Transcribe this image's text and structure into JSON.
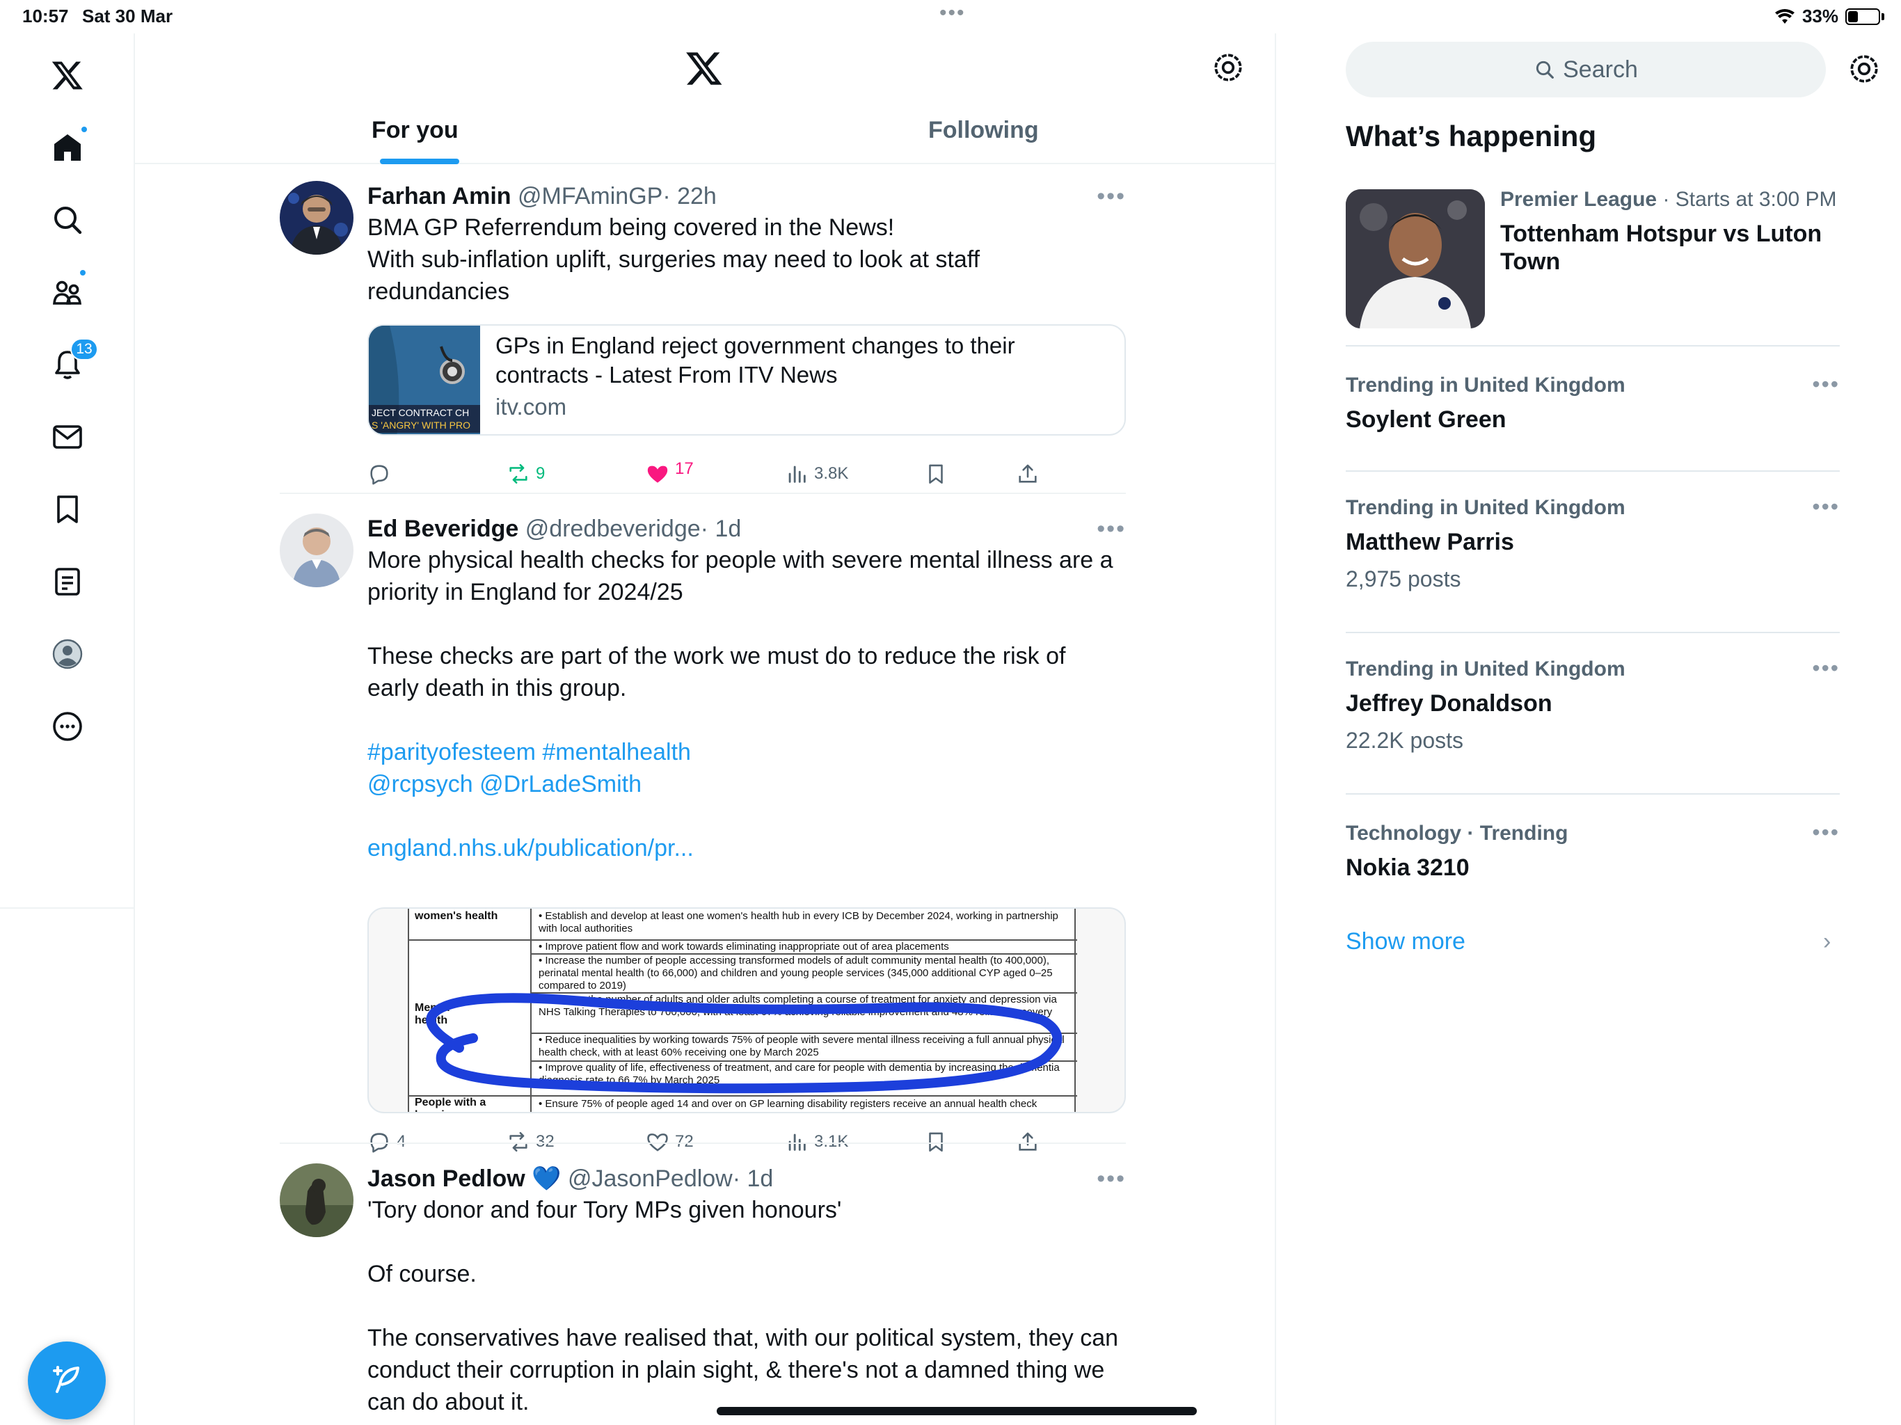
{
  "status": {
    "time": "10:57",
    "date": "Sat 30 Mar",
    "battery": "33%",
    "battery_level": 0.33
  },
  "nav": {
    "items": [
      "home",
      "explore",
      "communities",
      "notifications",
      "messages",
      "bookmarks",
      "lists",
      "profile",
      "more"
    ],
    "notifications_badge": "13"
  },
  "header": {
    "tabs": [
      {
        "label": "For you",
        "active": true
      },
      {
        "label": "Following",
        "active": false
      }
    ]
  },
  "tweets": [
    {
      "name": "Farhan Amin",
      "handle": "@MFAminGP",
      "time": "· 22h",
      "lines": [
        "BMA GP Referrendum being covered in the News!",
        "With sub-inflation uplift, surgeries may need to look at staff",
        "redundancies"
      ],
      "card": {
        "title_1": "GPs in England reject government changes to their",
        "title_2": "contracts - Latest From ITV News",
        "domain": "itv.com",
        "thumb_text_1": "JECT CONTRACT CH",
        "thumb_text_2": "S 'ANGRY' WITH PRO"
      },
      "replies": "",
      "reposts": "9",
      "likes": "17",
      "views": "3.8K",
      "liked": true,
      "reposted": true
    },
    {
      "name": "Ed Beveridge",
      "handle": "@dredbeveridge",
      "time": "· 1d",
      "lines": [
        "More physical health checks for people with severe mental illness are a",
        "priority in England for 2024/25",
        "",
        "These checks are part of the work we must do to reduce the risk of",
        "early death in this group.",
        ""
      ],
      "hashtags": "#parityofesteem #mentalhealth",
      "mentions": "@rcpsych @DrLadeSmith",
      "link": "england.nhs.uk/publication/pr...",
      "doc": {
        "label_womens": "women's health",
        "label_mental": "Mental health",
        "label_people": "People with a learning",
        "b1": "Establish and develop at least one women's health hub in every ICB by December 2024, working in partnership with local authorities",
        "b2": "Improve patient flow and work towards eliminating inappropriate out of area placements",
        "b3": "Increase the number of people accessing transformed models of adult community mental health (to 400,000), perinatal mental health (to 66,000) and children and young people services (345,000 additional CYP aged 0–25 compared to 2019)",
        "b4": "Increase the number of adults and older adults completing a course of treatment for anxiety and depression via NHS Talking Therapies to 700,000, with at least 67% achieving reliable improvement and 48% reliable recovery",
        "b5": "Reduce inequalities by working towards 75% of people with severe mental illness receiving a full annual physical health check, with at least 60% receiving one by March 2025",
        "b6": "Improve quality of life, effectiveness of treatment, and care for people with dementia by increasing the dementia diagnosis rate to 66.7% by March 2025",
        "b7": "Ensure 75% of people aged 14 and over on GP learning disability registers receive an annual health check"
      },
      "replies": "4",
      "reposts": "32",
      "likes": "72",
      "views": "3.1K"
    },
    {
      "name": "Jason Pedlow",
      "handle": "@JasonPedlow",
      "time": "· 1d",
      "emoji": "💙",
      "lines": [
        "'Tory donor and four Tory MPs given honours'",
        "",
        "Of course.",
        "",
        "The conservatives have realised that, with our political system, they can",
        "conduct their corruption in plain sight, & there's not a damned thing we",
        "can do about it."
      ]
    }
  ],
  "sidebar": {
    "search_placeholder": "Search",
    "whats_happening": "What’s happening",
    "event": {
      "category": "Premier League",
      "when": "· Starts at 3:00 PM",
      "title": "Tottenham Hotspur vs Luton Town"
    },
    "trends": [
      {
        "category": "Trending in United Kingdom",
        "name": "Soylent Green",
        "count": ""
      },
      {
        "category": "Trending in United Kingdom",
        "name": "Matthew Parris",
        "count": "2,975 posts"
      },
      {
        "category": "Trending in United Kingdom",
        "name": "Jeffrey Donaldson",
        "count": "22.2K posts"
      },
      {
        "category": "Technology · Trending",
        "name": "Nokia 3210",
        "count": ""
      }
    ],
    "show_more": "Show more"
  },
  "colors": {
    "accent": "#1d9bf0",
    "like": "#f91880",
    "repost": "#00ba7c",
    "text": "#0f1419",
    "muted": "#536471"
  }
}
